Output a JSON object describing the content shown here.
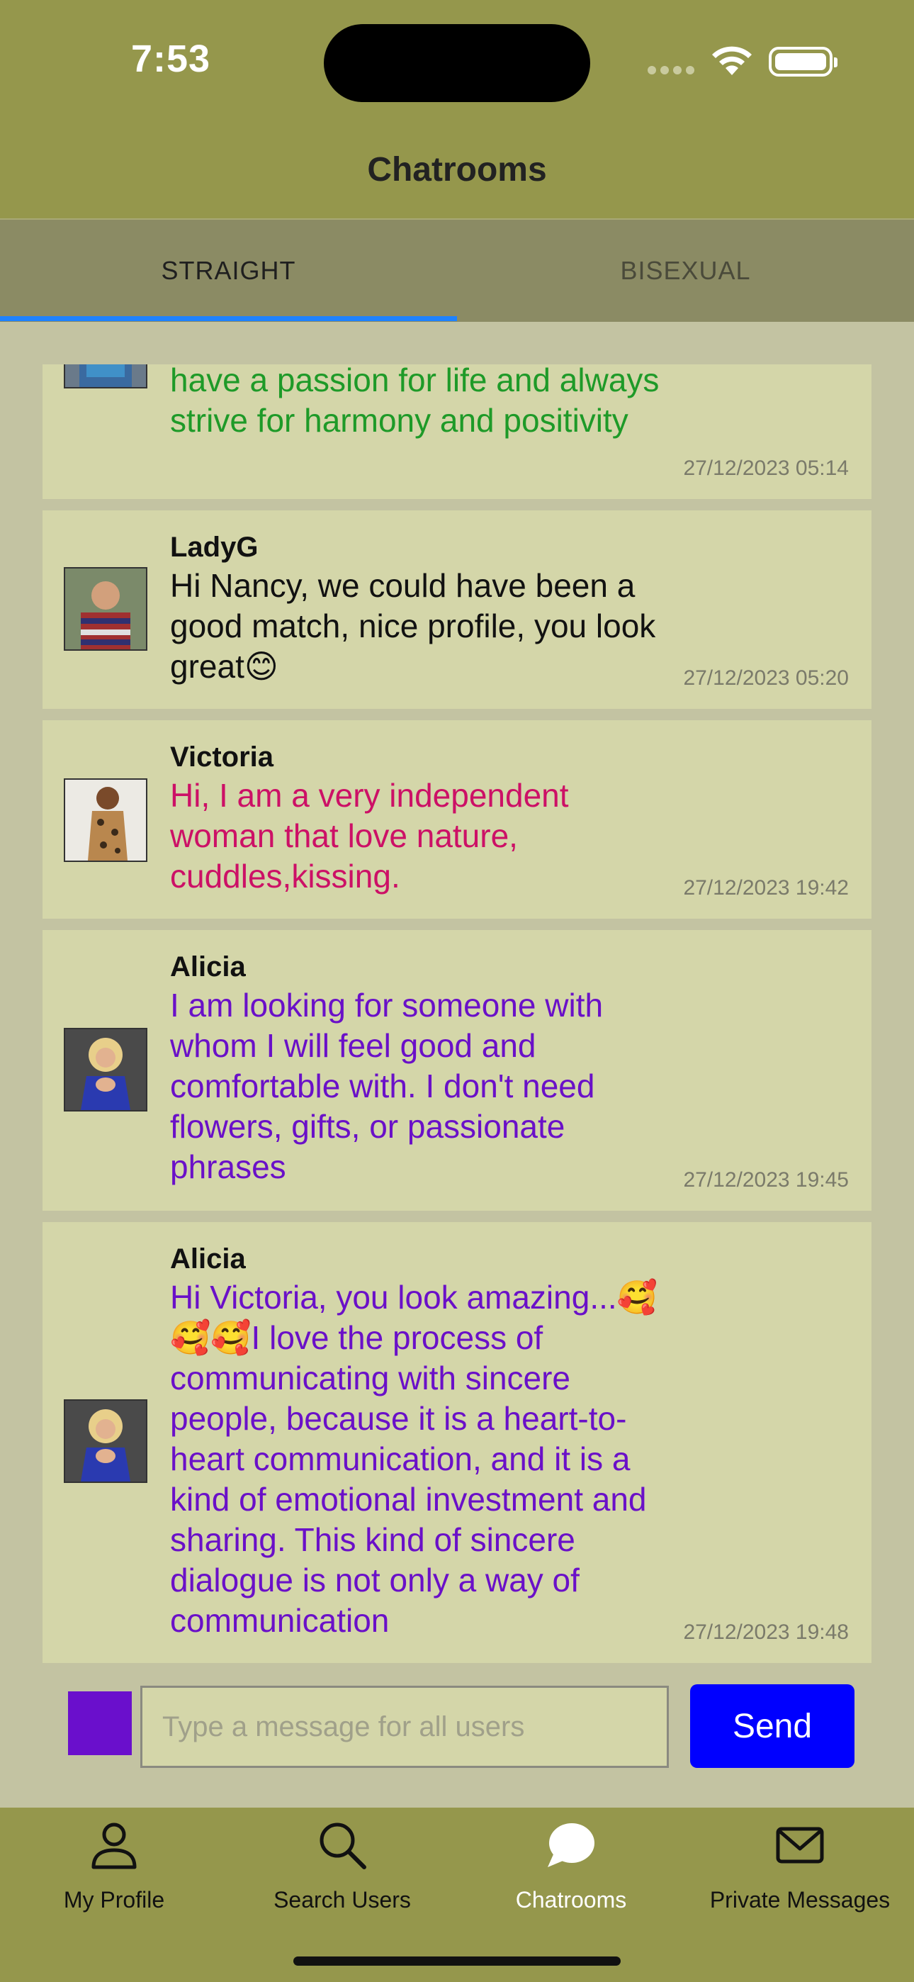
{
  "status_bar": {
    "time": "7:53"
  },
  "header": {
    "title": "Chatrooms"
  },
  "tabs": [
    {
      "label": "STRAIGHT",
      "selected": true
    },
    {
      "label": "BISEXUAL",
      "selected": false
    }
  ],
  "messages": [
    {
      "user": "",
      "text": "have a passion for life and always strive for harmony and positivity",
      "time": "27/12/2023 05:14",
      "color": "#1e9a28"
    },
    {
      "user": "LadyG",
      "text": "Hi Nancy, we could have been a good match, nice profile, you look great😊",
      "time": "27/12/2023 05:20",
      "color": "#111111"
    },
    {
      "user": "Victoria",
      "text": "Hi, I am a very independent woman that love nature, cuddles,kissing.",
      "time": "27/12/2023 19:42",
      "color": "#cc1066"
    },
    {
      "user": "Alicia",
      "text": "I am looking for someone with whom I will feel good and comfortable with. I don't need flowers, gifts, or passionate phrases",
      "time": "27/12/2023 19:45",
      "color": "#6a10c8"
    },
    {
      "user": "Alicia",
      "text": "Hi Victoria, you look amazing...🥰🥰🥰I love the process of communicating with sincere people, because it is a heart-to-heart communication, and it is a kind of emotional investment and sharing. This kind of sincere dialogue is not only a way of communication",
      "time": "27/12/2023 19:48",
      "color": "#6a10c8"
    }
  ],
  "composer": {
    "placeholder": "Type a message for all users",
    "send_label": "Send",
    "color_swatch": "#6a0fcc"
  },
  "bottom_nav": [
    {
      "label": "My Profile",
      "icon": "person-icon"
    },
    {
      "label": "Search Users",
      "icon": "search-icon"
    },
    {
      "label": "Chatrooms",
      "icon": "chat-bubble-icon",
      "active": true
    },
    {
      "label": "Private Messages",
      "icon": "envelope-icon"
    }
  ]
}
